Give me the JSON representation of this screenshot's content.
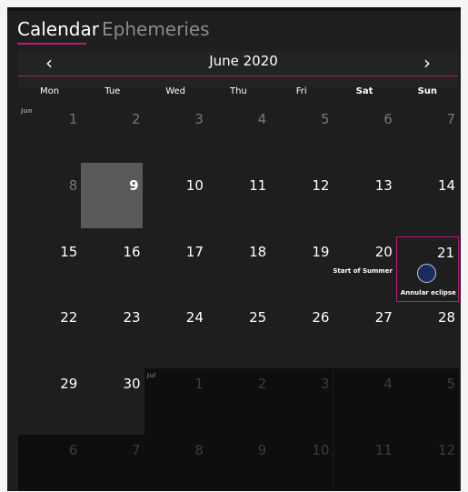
{
  "tabs": [
    {
      "label": "Calendar",
      "active": true
    },
    {
      "label": "Ephemeries",
      "active": false
    }
  ],
  "month_header": {
    "title": "June 2020",
    "prev_icon": "chevron-left-icon",
    "next_icon": "chevron-right-icon"
  },
  "weekdays": [
    "Mon",
    "Tue",
    "Wed",
    "Thu",
    "Fri",
    "Sat",
    "Sun"
  ],
  "days": [
    {
      "n": "1",
      "label": "Jun",
      "state": "dim"
    },
    {
      "n": "2",
      "state": "dim"
    },
    {
      "n": "3",
      "state": "dim"
    },
    {
      "n": "4",
      "state": "dim"
    },
    {
      "n": "5",
      "state": "dim"
    },
    {
      "n": "6",
      "state": "dim"
    },
    {
      "n": "7",
      "state": "dim"
    },
    {
      "n": "8",
      "state": "dim"
    },
    {
      "n": "9",
      "state": "today"
    },
    {
      "n": "10",
      "state": "normal"
    },
    {
      "n": "11",
      "state": "normal"
    },
    {
      "n": "12",
      "state": "normal"
    },
    {
      "n": "13",
      "state": "normal"
    },
    {
      "n": "14",
      "state": "normal"
    },
    {
      "n": "15",
      "state": "normal"
    },
    {
      "n": "16",
      "state": "normal"
    },
    {
      "n": "17",
      "state": "normal"
    },
    {
      "n": "18",
      "state": "normal"
    },
    {
      "n": "19",
      "state": "normal"
    },
    {
      "n": "20",
      "state": "normal",
      "event": "Start of Summer"
    },
    {
      "n": "21",
      "state": "selected",
      "event": "Annular eclipse",
      "icon": "eclipse-icon"
    },
    {
      "n": "22",
      "state": "normal"
    },
    {
      "n": "23",
      "state": "normal"
    },
    {
      "n": "24",
      "state": "normal"
    },
    {
      "n": "25",
      "state": "normal"
    },
    {
      "n": "26",
      "state": "normal"
    },
    {
      "n": "27",
      "state": "normal"
    },
    {
      "n": "28",
      "state": "normal"
    },
    {
      "n": "29",
      "state": "normal"
    },
    {
      "n": "30",
      "state": "normal"
    },
    {
      "n": "1",
      "label": "Jul",
      "state": "faint"
    },
    {
      "n": "2",
      "state": "faint"
    },
    {
      "n": "3",
      "state": "faint"
    },
    {
      "n": "4",
      "state": "faint"
    },
    {
      "n": "5",
      "state": "faint"
    },
    {
      "n": "6",
      "state": "faint"
    },
    {
      "n": "7",
      "state": "faint"
    },
    {
      "n": "8",
      "state": "faint"
    },
    {
      "n": "9",
      "state": "faint"
    },
    {
      "n": "10",
      "state": "faint"
    },
    {
      "n": "11",
      "state": "faint"
    },
    {
      "n": "12",
      "state": "faint"
    }
  ],
  "colors": {
    "accent": "#c2187a",
    "background": "#1e1e1e",
    "today": "#5a5a5a",
    "next_month": "#0e0e0e"
  }
}
